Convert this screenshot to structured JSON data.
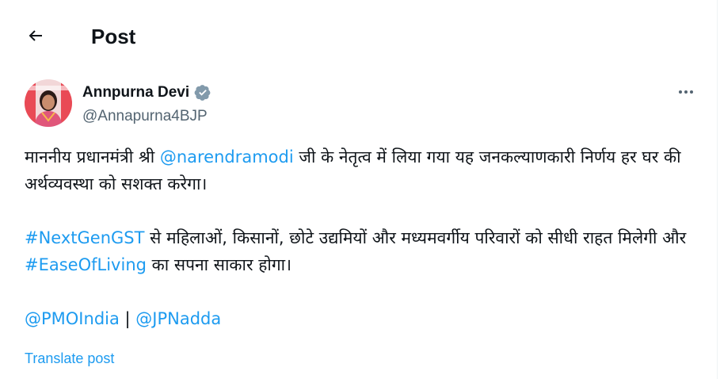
{
  "header": {
    "title": "Post"
  },
  "author": {
    "name": "Annpurna Devi",
    "handle": "@Annapurna4BJP",
    "verified": true
  },
  "tweet": {
    "line1_pre": "माननीय प्रधानमंत्री श्री ",
    "line1_mention": "@narendramodi",
    "line1_post": " जी के नेतृत्व में लिया गया यह जनकल्याणकारी निर्णय हर घर की अर्थव्यवस्था को सशक्त करेगा।",
    "hashtag1": "#NextGenGST",
    "line2_mid": " से महिलाओं, किसानों, छोटे उद्यमियों और मध्यमवर्गीय परिवारों को सीधी राहत मिलेगी और ",
    "hashtag2": "#EaseOfLiving",
    "line2_post": " का सपना साकार होगा।",
    "mention_pmo": "@PMOIndia",
    "separator": " | ",
    "mention_jpn": "@JPNadda"
  },
  "translate_label": "Translate post",
  "colors": {
    "link": "#1d9bf0",
    "verified_badge": "#829aab",
    "muted": "#536471",
    "text": "#0f1419"
  },
  "icons": {
    "back": "arrow-left-icon",
    "verified": "verified-badge-icon",
    "more": "more-options-icon"
  }
}
